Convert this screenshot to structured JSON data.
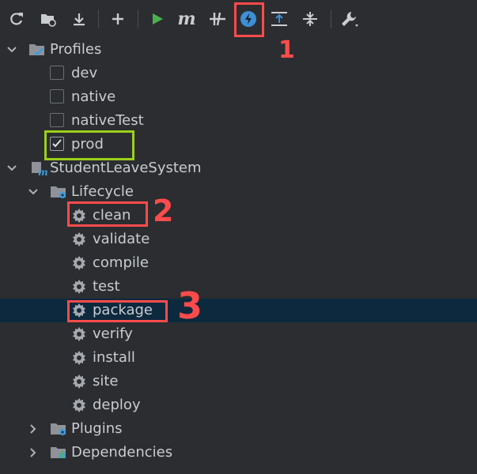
{
  "toolbar": {
    "buttons": [
      {
        "icon": "reload-icon"
      },
      {
        "icon": "reimport-folder-icon"
      },
      {
        "icon": "download-sources-icon"
      },
      {
        "icon": "add-icon"
      },
      {
        "icon": "run-icon"
      },
      {
        "icon": "execute-maven-goal-icon",
        "glyph": "m"
      },
      {
        "icon": "toggle-skip-tests-icon"
      },
      {
        "icon": "offline-mode-icon"
      },
      {
        "icon": "expand-all-icon"
      },
      {
        "icon": "collapse-all-icon"
      },
      {
        "icon": "settings-wrench-icon"
      }
    ]
  },
  "tree": {
    "profiles": {
      "label": "Profiles",
      "items": [
        {
          "label": "dev",
          "checked": false
        },
        {
          "label": "native",
          "checked": false
        },
        {
          "label": "nativeTest",
          "checked": false
        },
        {
          "label": "prod",
          "checked": true
        }
      ]
    },
    "project": {
      "label": "StudentLeaveSystem",
      "lifecycle": {
        "label": "Lifecycle",
        "goals": [
          "clean",
          "validate",
          "compile",
          "test",
          "package",
          "verify",
          "install",
          "site",
          "deploy"
        ],
        "selected": "package"
      },
      "plugins": {
        "label": "Plugins"
      },
      "dependencies": {
        "label": "Dependencies"
      }
    }
  },
  "annotations": {
    "num1": "1",
    "num2": "2",
    "num3": "3",
    "red": "#ff4b4b",
    "green": "#9bd01a"
  },
  "colors": {
    "run_green": "#4caf50",
    "offline_blue": "#3d8fd6",
    "selection": "#0d293e"
  }
}
